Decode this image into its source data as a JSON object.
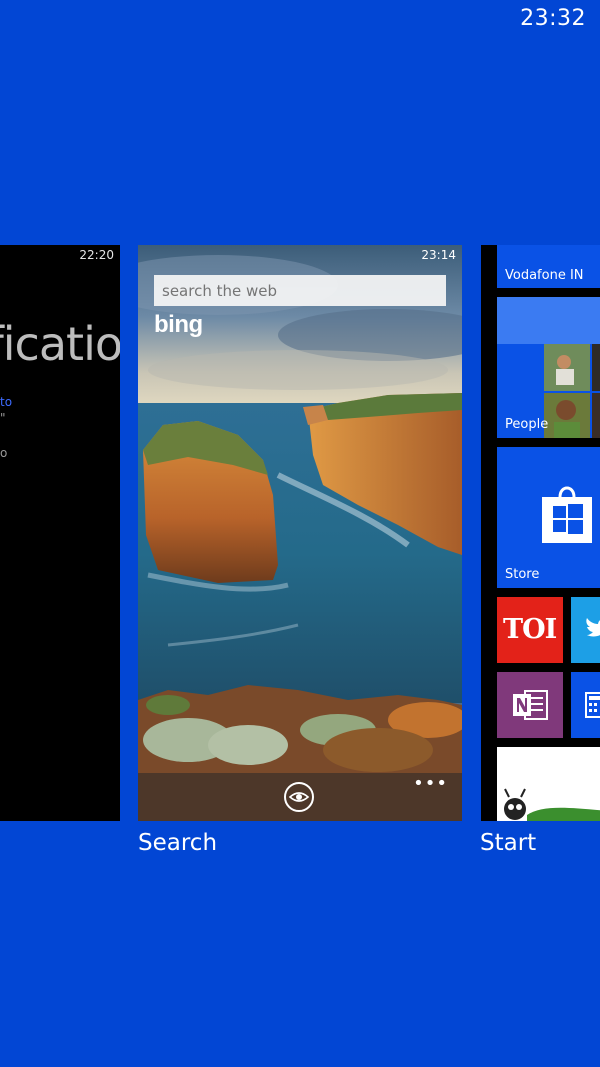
{
  "status_bar": {
    "time": "23:32"
  },
  "cards": {
    "notifications": {
      "time": "22:20",
      "title_fragment": "tificatio",
      "line1": "to",
      "line2": "\"",
      "line3": "o"
    },
    "search": {
      "time": "23:14",
      "search_placeholder": "search the web",
      "logo": "bing",
      "more_label": "•••",
      "caption": "Search"
    },
    "start": {
      "caption": "Start",
      "tiles": {
        "vodafone": "Vodafone IN",
        "people": "People",
        "store": "Store",
        "toi": "TOI"
      }
    }
  },
  "colors": {
    "background": "#0246d4",
    "tile_blue": "#0a52e6",
    "toi_red": "#e32219",
    "twitter_blue": "#1d9fe6",
    "onenote_purple": "#80397b"
  }
}
